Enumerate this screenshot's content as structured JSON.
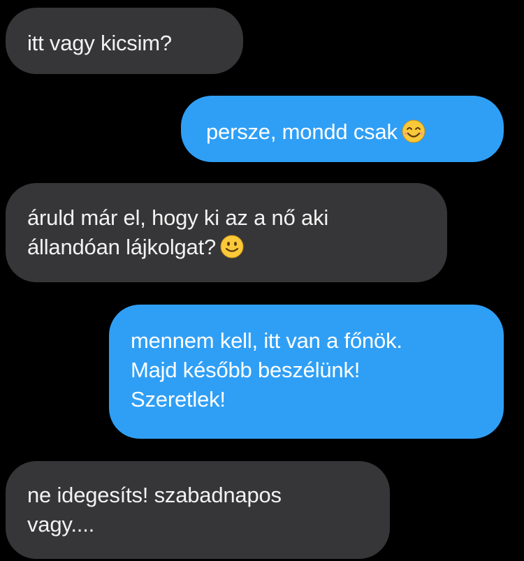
{
  "messages": [
    {
      "direction": "incoming",
      "lines": [
        "itt vagy kicsim?"
      ]
    },
    {
      "direction": "outgoing",
      "lines": [
        "persze, mondd csak"
      ],
      "emoji": "smiling-face-with-smiling-eyes-icon"
    },
    {
      "direction": "incoming",
      "lines": [
        "áruld már el, hogy ki az a nő aki",
        "állandóan lájkolgat?"
      ],
      "emoji": "slightly-smiling-face-icon"
    },
    {
      "direction": "outgoing",
      "lines": [
        "mennem kell, itt van a főnök.",
        "Majd később beszélünk!",
        "Szeretlek!"
      ]
    },
    {
      "direction": "incoming",
      "lines": [
        "ne idegesíts! szabadnapos",
        "vagy...."
      ]
    }
  ],
  "colors": {
    "background": "#000000",
    "incoming_bubble": "#363638",
    "outgoing_bubble": "#2f9ff6",
    "emoji_face": "#f9c93a"
  }
}
